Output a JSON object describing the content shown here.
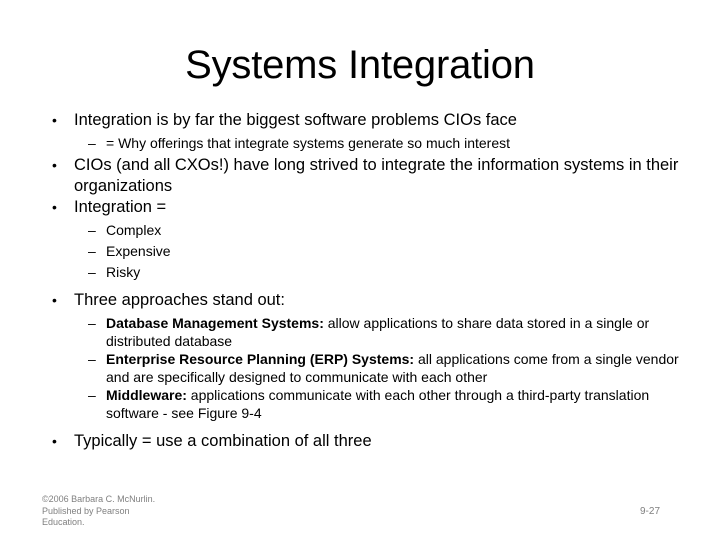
{
  "slide": {
    "title": "Systems Integration",
    "background_color": "#ffffff",
    "text_color": "#000000",
    "footer_color": "#808080"
  },
  "content": {
    "b1": {
      "marker": "•",
      "text": "Integration is by far the biggest software problems CIOs face"
    },
    "b1s1": {
      "marker": "–",
      "text": "= Why offerings that integrate systems generate so much interest"
    },
    "b2": {
      "marker": "•",
      "text": "CIOs (and all CXOs!) have long strived to integrate the information systems in their organizations"
    },
    "b3": {
      "marker": "•",
      "text": "Integration ="
    },
    "b3s1": {
      "marker": "–",
      "text": "Complex"
    },
    "b3s2": {
      "marker": "–",
      "text": "Expensive"
    },
    "b3s3": {
      "marker": "–",
      "text": "Risky"
    },
    "b4": {
      "marker": "•",
      "text": "Three approaches stand out:"
    },
    "b4s1": {
      "marker": "–",
      "lead": "Database Management Systems:",
      "text": " allow applications to share data stored in a single or distributed database"
    },
    "b4s2": {
      "marker": "–",
      "lead": "Enterprise Resource Planning (ERP) Systems:",
      "text": " all applications come from a single vendor and are specifically designed to communicate with each other"
    },
    "b4s3": {
      "marker": "–",
      "lead": "Middleware:",
      "text": " applications communicate with each other through a third-party translation software - see Figure 9-4"
    },
    "b5": {
      "marker": "•",
      "text": "Typically = use a combination of all three"
    }
  },
  "footer": {
    "credit_line1": "©2006 Barbara C. McNurlin.",
    "credit_line2": "Published by Pearson",
    "credit_line3": "Education.",
    "page_number": "9-27"
  }
}
